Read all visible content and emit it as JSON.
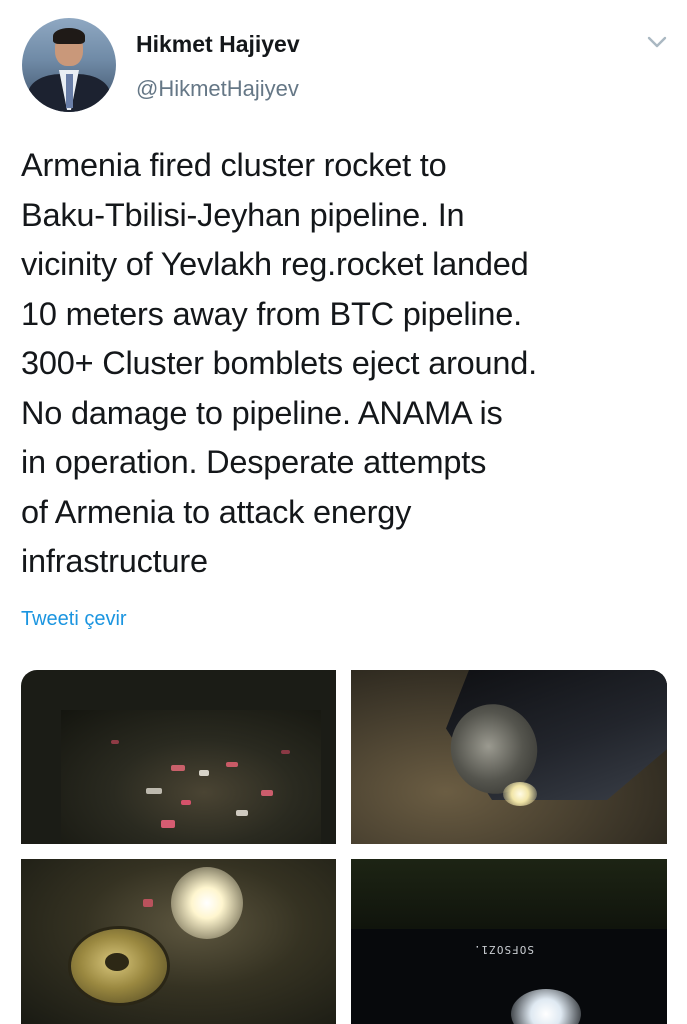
{
  "user": {
    "display_name": "Hikmet Hajiyev",
    "handle": "@HikmetHajiyev"
  },
  "icons": {
    "menu": "chevron-down-icon",
    "avatar": "avatar"
  },
  "tweet": {
    "text": "Armenia fired cluster rocket to\nBaku-Tbilisi-Jeyhan pipeline. In\nvicinity of Yevlakh reg.rocket landed\n10 meters away from BTC pipeline.\n300+ Cluster bomblets eject around.\nNo damage to pipeline. ANAMA is\nin operation. Desperate attempts\nof Armenia to attack energy\ninfrastructure",
    "translate_label": "Tweeti çevir"
  },
  "media": {
    "photo_4_stencil": "SOFSOZ1."
  },
  "colors": {
    "name": "#14171a",
    "handle": "#657786",
    "link": "#1b95e0",
    "chevron": "#aab8c2"
  }
}
